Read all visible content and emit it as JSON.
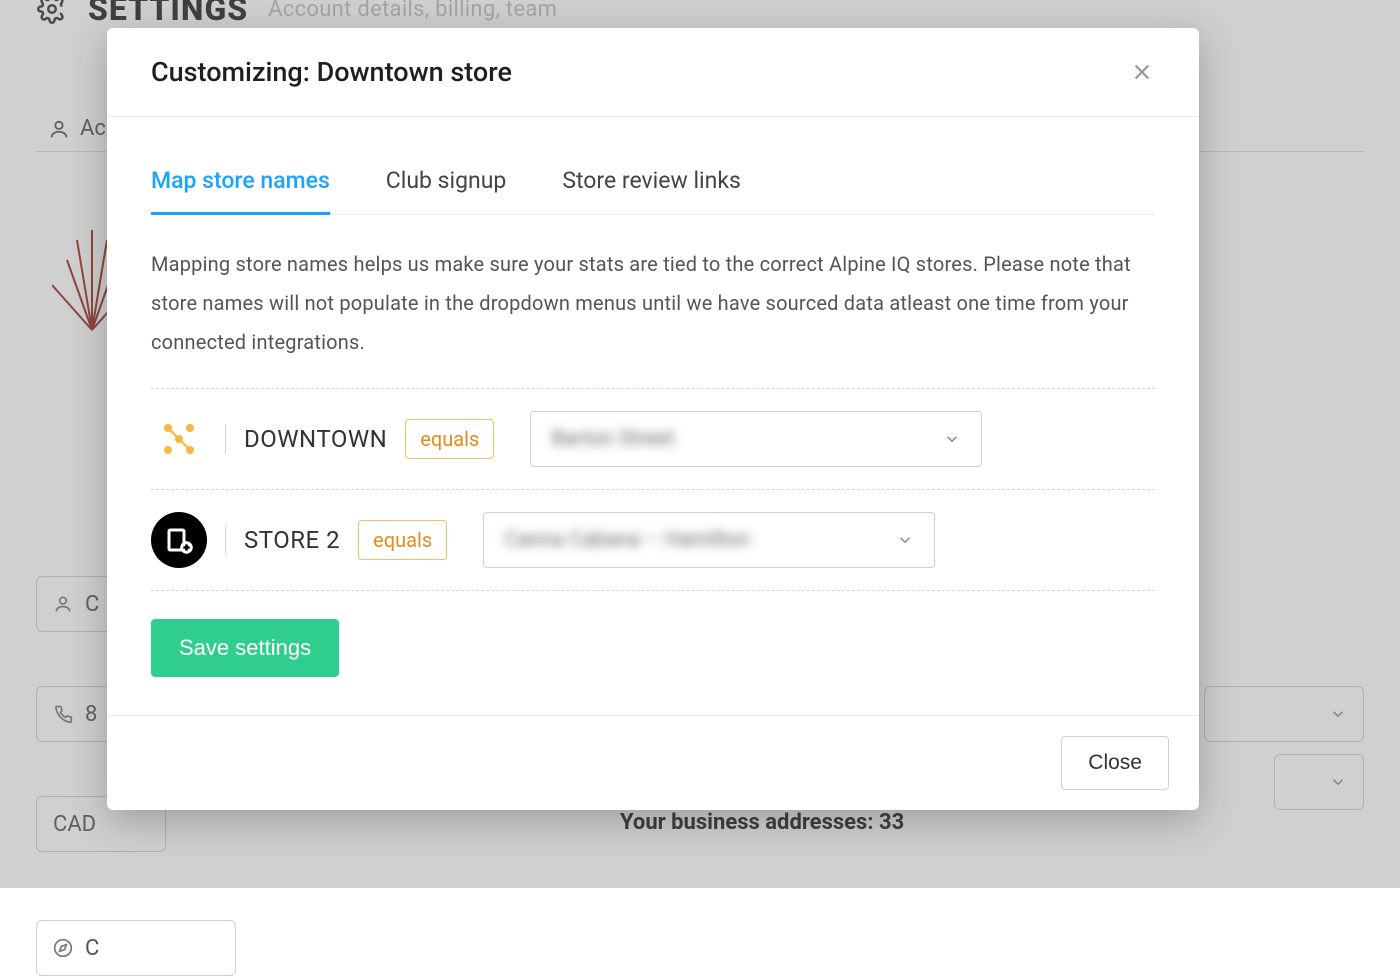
{
  "bg": {
    "page_title": "SETTINGS",
    "page_subtitle": "Account details, billing, team",
    "tab_account": "Acc",
    "field_user_partial": "C",
    "field_phone_partial": "8",
    "field_currency": "CAD",
    "field_compass_partial": "C",
    "addresses_label": "Your business addresses:",
    "addresses_count": "33"
  },
  "modal": {
    "title": "Customizing: Downtown store",
    "tabs": {
      "map": "Map store names",
      "club": "Club signup",
      "review": "Store review links"
    },
    "help": "Mapping store names helps us make sure your stats are tied to the correct Alpine IQ stores. Please note that store names will not populate in the dropdown menus until we have sourced data atleast one time from your connected integrations.",
    "rows": [
      {
        "store": "DOWNTOWN",
        "equals": "equals",
        "selected": "Barton Street"
      },
      {
        "store": "STORE 2",
        "equals": "equals",
        "selected": "Canna Cabana – Hamilton"
      }
    ],
    "save_label": "Save settings",
    "close_label": "Close"
  }
}
